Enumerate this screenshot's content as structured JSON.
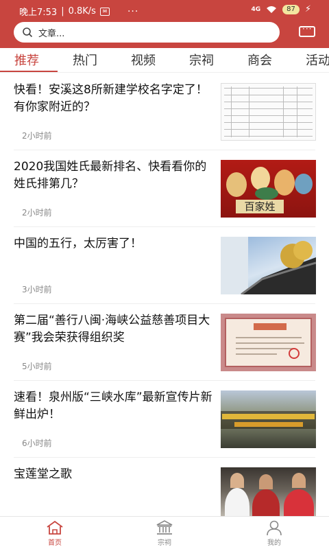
{
  "status_bar": {
    "time": "晚上7:53",
    "speed": "0.8K/s",
    "menu_dots": "···",
    "signal": "4G",
    "battery": "87"
  },
  "search": {
    "placeholder": "文章..."
  },
  "tabs": [
    {
      "label": "推荐",
      "active": true
    },
    {
      "label": "热门"
    },
    {
      "label": "视频"
    },
    {
      "label": "宗祠"
    },
    {
      "label": "商会"
    },
    {
      "label": "活动"
    }
  ],
  "articles": [
    {
      "title": "快看！安溪这8所新建学校名字定了！有你家附近的？",
      "time": "2小时前",
      "thumb": "table-document"
    },
    {
      "title": "2020我国姓氏最新排名、快看看你的姓氏排第几？",
      "time": "2小时前",
      "thumb": "baijiaxing-illustration",
      "thumb_text": "百家姓"
    },
    {
      "title": "中国的五行，太厉害了！",
      "time": "3小时前",
      "thumb": "roof-eaves-photo"
    },
    {
      "title": "第二届“善行八闽·海峡公益慈善项目大赛”我会荣获得组织奖",
      "time": "5小时前",
      "thumb": "certificate-photo"
    },
    {
      "title": "速看！泉州版“三峡水库”最新宣传片新鲜出炉！",
      "time": "6小时前",
      "thumb": "reservoir-video-still"
    },
    {
      "title": "宝莲堂之歌",
      "time": "",
      "thumb": "group-people-photo"
    }
  ],
  "bottom_nav": [
    {
      "label": "首页",
      "icon": "home-icon",
      "active": true
    },
    {
      "label": "宗祠",
      "icon": "temple-icon"
    },
    {
      "label": "我的",
      "icon": "user-icon"
    }
  ],
  "colors": {
    "brand": "#c8453f",
    "text": "#111111",
    "muted": "#888888"
  }
}
